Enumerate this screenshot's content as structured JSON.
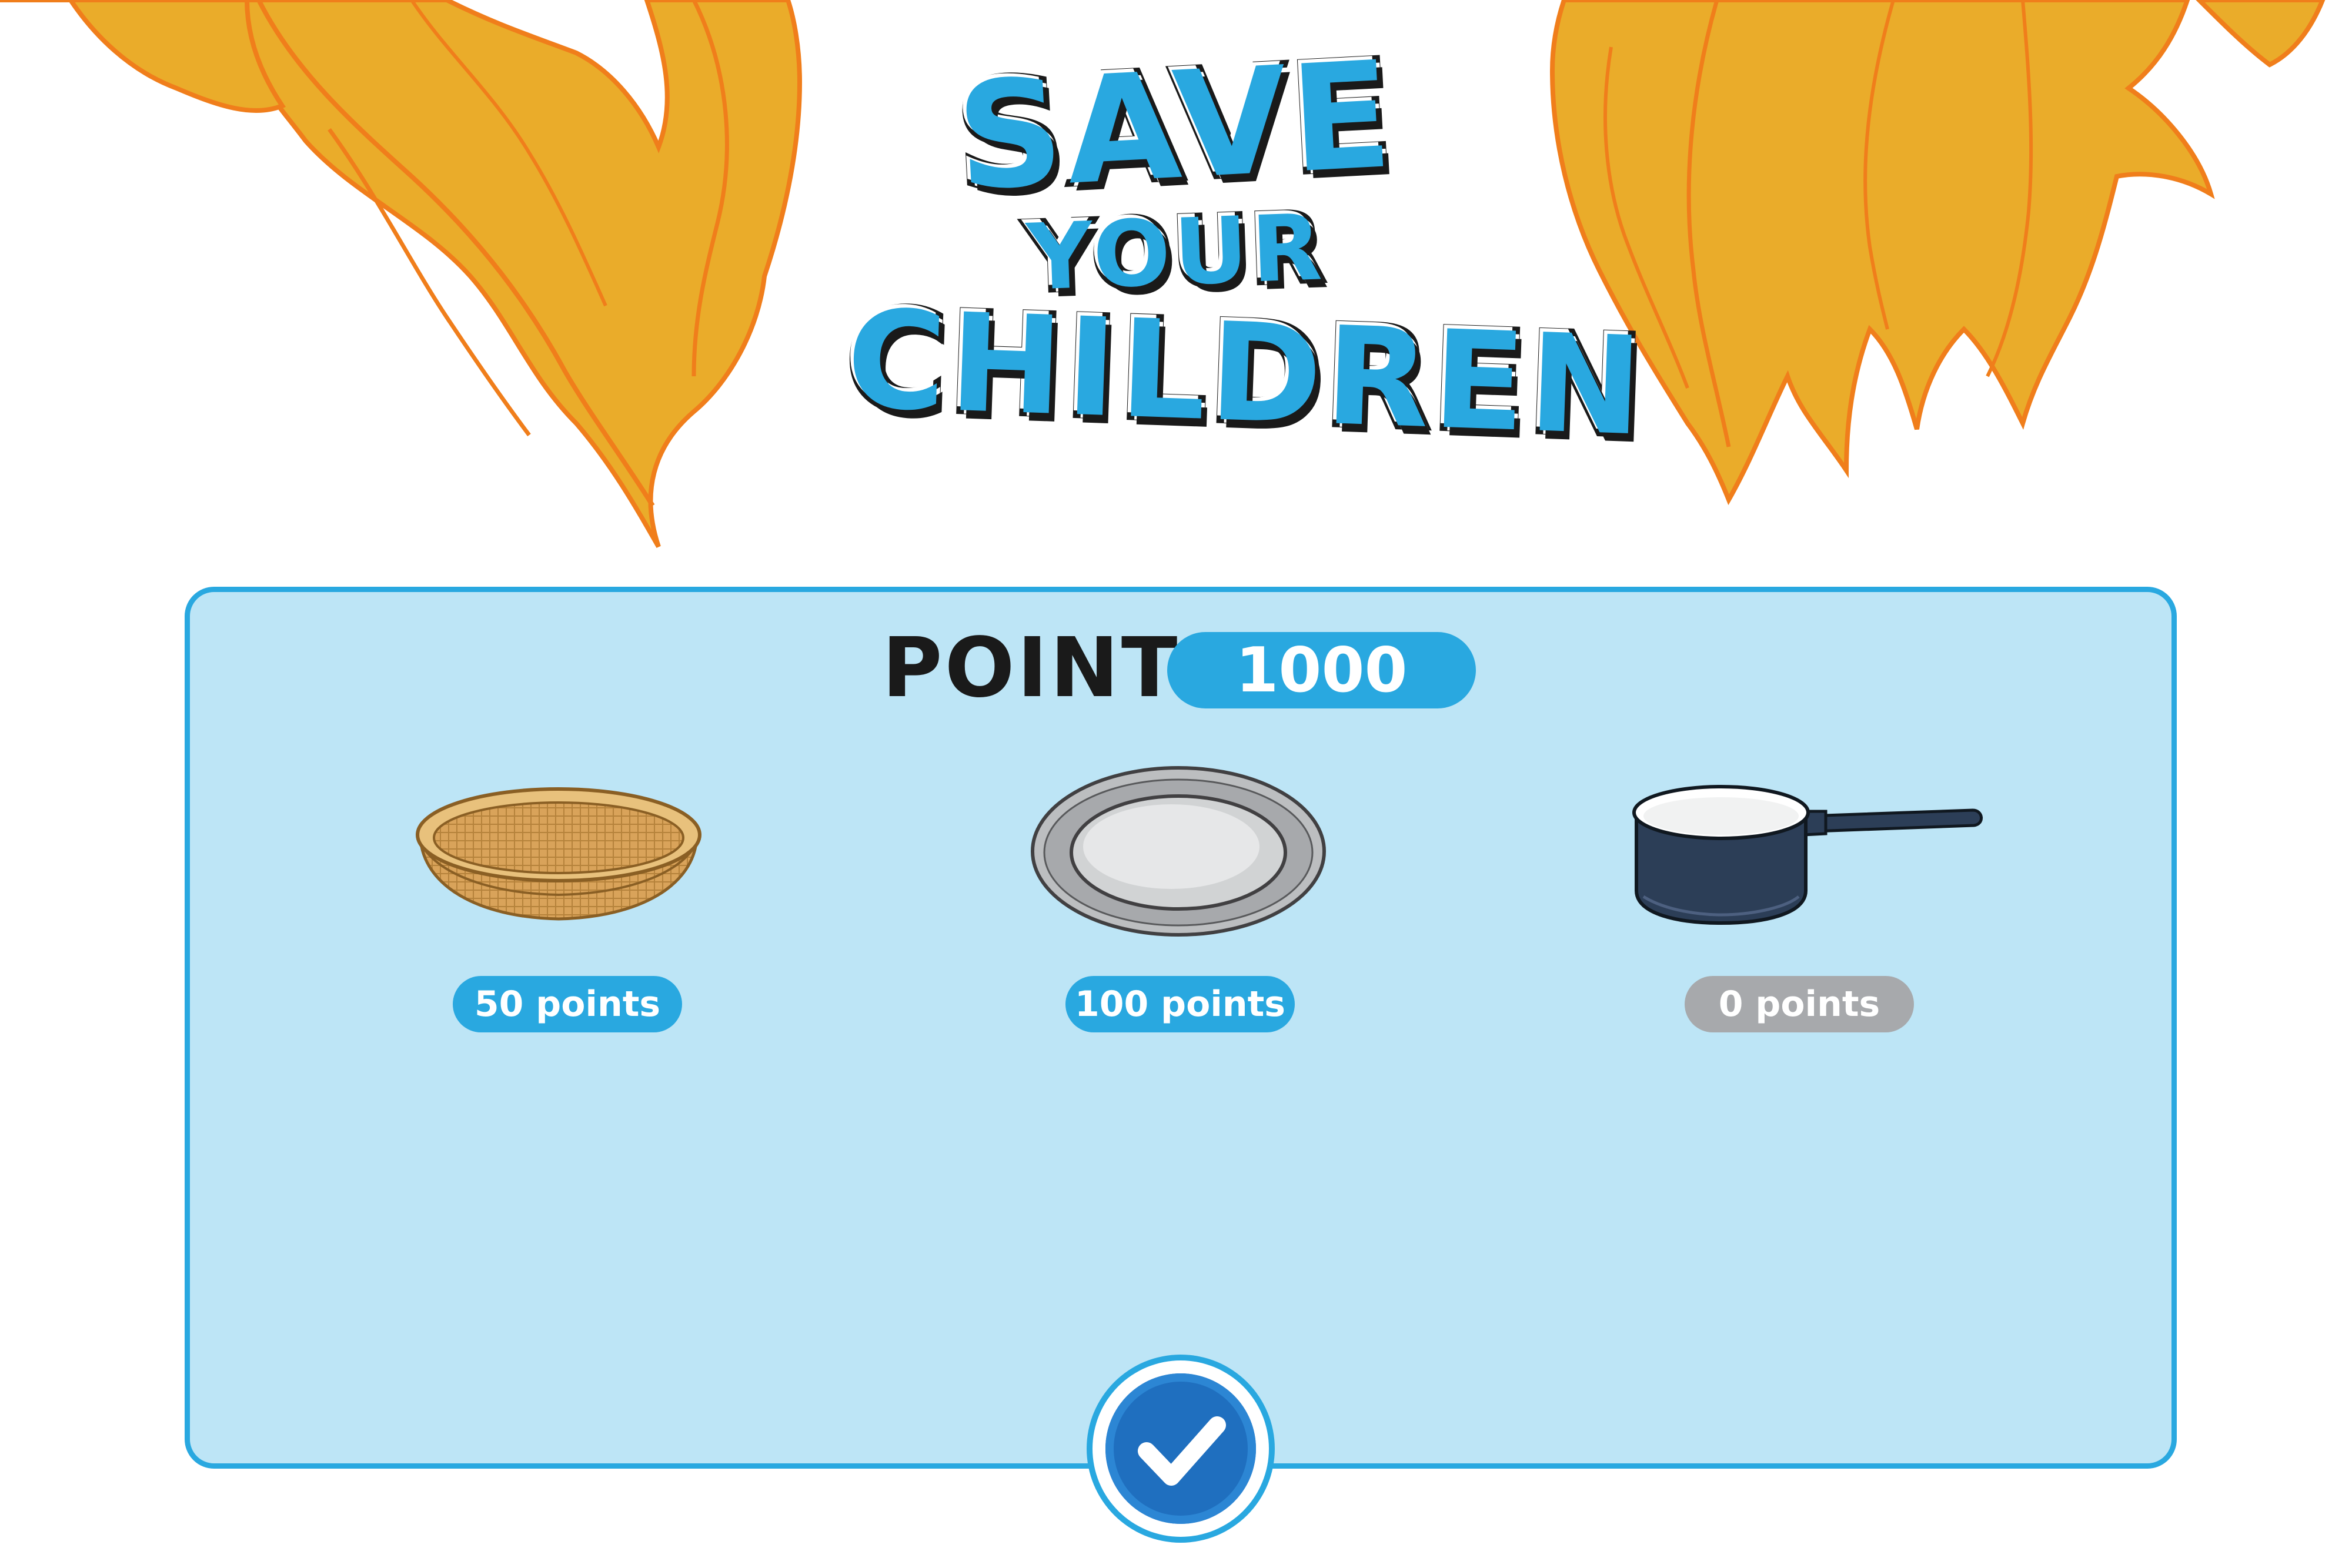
{
  "title": {
    "line1": "SAVE",
    "line2": "YOUR",
    "line3": "CHILDREN"
  },
  "score": {
    "label": "POINTS",
    "value": "1000"
  },
  "items": [
    {
      "name": "basket",
      "points_label": "50 points",
      "badge_color": "#29a8e0"
    },
    {
      "name": "plate",
      "points_label": "100 points",
      "badge_color": "#29a8e0"
    },
    {
      "name": "saucepan",
      "points_label": "0 points",
      "badge_color": "#a7a9ac"
    }
  ],
  "colors": {
    "accent": "#29a8e0",
    "panel": "#bde5f6",
    "fire": "#eaac2a",
    "fire_outline": "#f07e1b",
    "confirm": "#1f6fbf",
    "disabled": "#a7a9ac"
  },
  "confirm_button": {
    "icon": "checkmark-icon"
  }
}
